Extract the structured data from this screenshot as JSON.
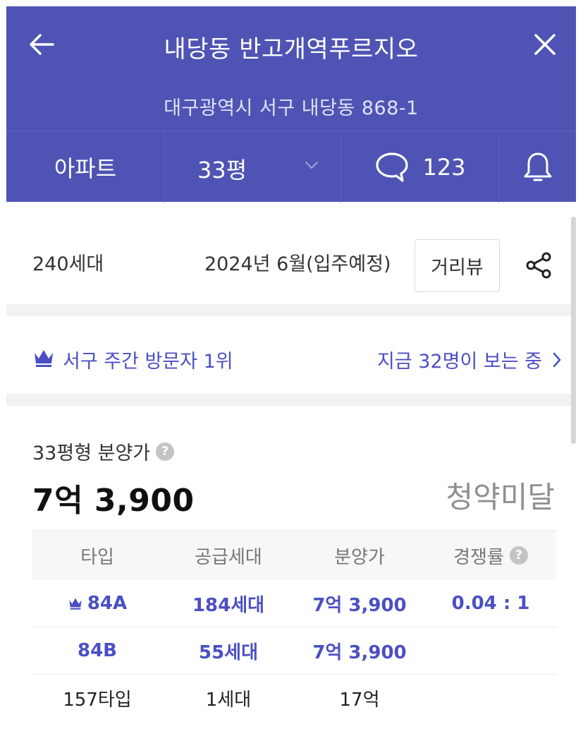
{
  "header": {
    "title": "내당동 반고개역푸르지오",
    "address": "대구광역시 서구 내당동 868-1"
  },
  "tabs": {
    "type_label": "아파트",
    "size_label": "33평",
    "comment_count": "123"
  },
  "info": {
    "households": "240세대",
    "move_in": "2024년 6월(입주예정)",
    "streetview_label": "거리뷰"
  },
  "ranking": {
    "rank_text": "서구 주간 방문자 1위",
    "viewers_text": "지금 32명이 보는 중"
  },
  "price": {
    "label": "33평형 분양가",
    "value": "7억 3,900",
    "status": "청약미달"
  },
  "table": {
    "headers": [
      "타입",
      "공급세대",
      "분양가",
      "경쟁률"
    ],
    "rows": [
      {
        "type": "84A",
        "supply": "184세대",
        "price": "7억 3,900",
        "ratio": "0.04 : 1"
      },
      {
        "type": "84B",
        "supply": "55세대",
        "price": "7억 3,900",
        "ratio": ""
      },
      {
        "type": "157타입",
        "supply": "1세대",
        "price": "17억",
        "ratio": ""
      }
    ]
  },
  "colors": {
    "header_bg": "#4f53b3",
    "accent": "#4b4fc4",
    "muted": "#8f8f8f"
  },
  "icons": [
    "back-arrow-icon",
    "close-icon",
    "chevron-down-icon",
    "comment-icon",
    "bell-icon",
    "share-icon",
    "crown-icon",
    "chevron-right-icon",
    "help-icon"
  ]
}
